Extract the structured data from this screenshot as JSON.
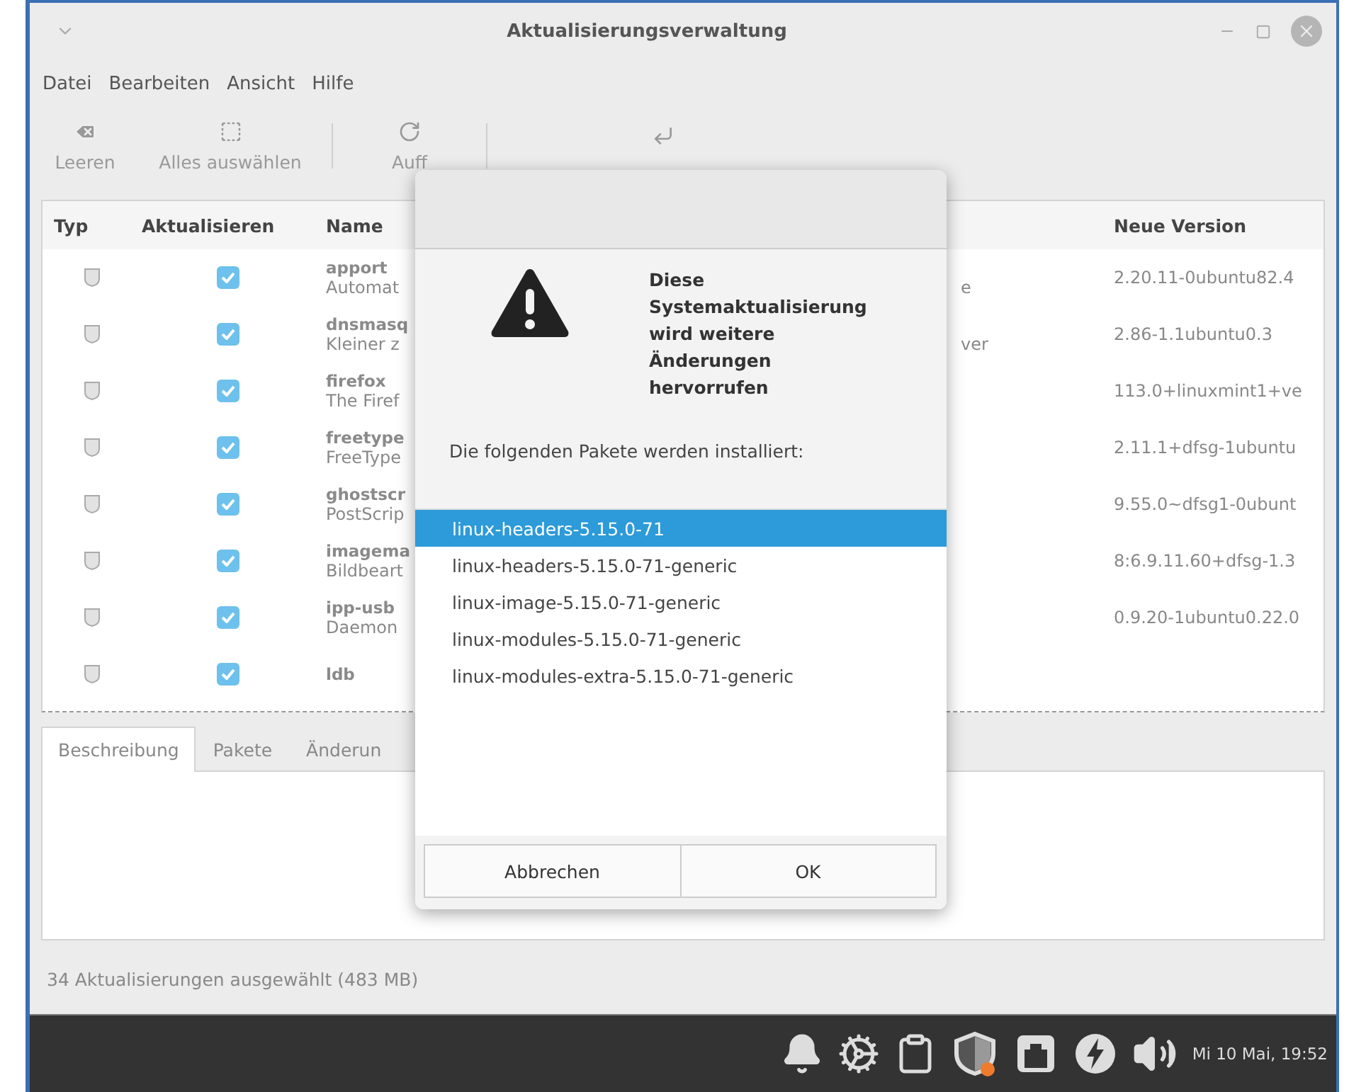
{
  "window": {
    "title": "Aktualisierungsverwaltung"
  },
  "menu": [
    "Datei",
    "Bearbeiten",
    "Ansicht",
    "Hilfe"
  ],
  "toolbar": [
    {
      "kind": "clear",
      "label": "Leeren"
    },
    {
      "kind": "select-all",
      "label": "Alles auswählen"
    },
    {
      "kind": "refresh",
      "label": "Auff"
    },
    {
      "kind": "install"
    }
  ],
  "table": {
    "columns": [
      "Typ",
      "Aktualisieren",
      "Name",
      "Neue Version"
    ],
    "rows": [
      {
        "checked": true,
        "name": "apport",
        "description": "Automat",
        "tail": "e",
        "new_version": "2.20.11-0ubuntu82.4"
      },
      {
        "checked": true,
        "name": "dnsmasq",
        "description": "Kleiner z",
        "tail": "ver",
        "new_version": "2.86-1.1ubuntu0.3"
      },
      {
        "checked": true,
        "name": "firefox",
        "description": "The Firef",
        "new_version": "113.0+linuxmint1+ve"
      },
      {
        "checked": true,
        "name": "freetype",
        "description": "FreeType",
        "new_version": "2.11.1+dfsg-1ubuntu"
      },
      {
        "checked": true,
        "name": "ghostscr",
        "description": "PostScrip",
        "new_version": "9.55.0~dfsg1-0ubunt"
      },
      {
        "checked": true,
        "name": "imagema",
        "description": "Bildbeart",
        "new_version": "8:6.9.11.60+dfsg-1.3"
      },
      {
        "checked": true,
        "name": "ipp-usb",
        "description": "Daemon",
        "new_version": "0.9.20-1ubuntu0.22.0"
      },
      {
        "checked": true,
        "name": "ldb"
      }
    ]
  },
  "details": {
    "tabs": [
      {
        "label": "Beschreibung",
        "selected": true
      },
      {
        "label": "Pakete",
        "selected": false
      },
      {
        "label": "Änderun",
        "selected": false
      }
    ]
  },
  "status_bar": "34 Aktualisierungen ausgewählt (483 MB)",
  "dialog": {
    "title": "Diese Systemaktualisierung wird weitere Änderungen hervorrufen",
    "message": "Die folgenden Pakete werden installiert:",
    "packages": [
      {
        "name": "linux-headers-5.15.0-71",
        "selected": true
      },
      {
        "name": "linux-headers-5.15.0-71-generic",
        "selected": false
      },
      {
        "name": "linux-image-5.15.0-71-generic",
        "selected": false
      },
      {
        "name": "linux-modules-5.15.0-71-generic",
        "selected": false
      },
      {
        "name": "linux-modules-extra-5.15.0-71-generic",
        "selected": false
      }
    ],
    "buttons": [
      "Abbrechen",
      "OK"
    ]
  },
  "taskbar": {
    "clock": "Mi 10 Mai, 19:52"
  }
}
